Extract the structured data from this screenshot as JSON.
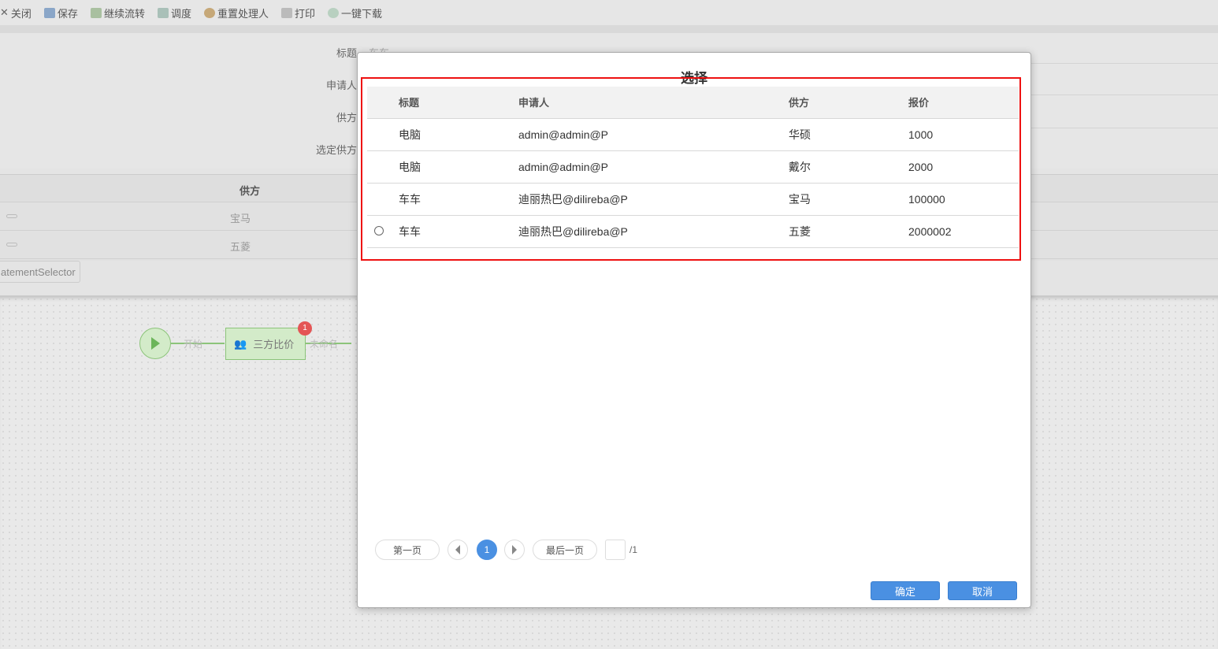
{
  "toolbar": {
    "items": [
      {
        "label": "关闭",
        "icon": "close-icon"
      },
      {
        "label": "保存",
        "icon": "save-icon"
      },
      {
        "label": "继续流转",
        "icon": "forward-icon"
      },
      {
        "label": "调度",
        "icon": "dispatch-icon"
      },
      {
        "label": "重置处理人",
        "icon": "reset-handler-icon"
      },
      {
        "label": "打印",
        "icon": "print-icon"
      },
      {
        "label": "一键下载",
        "icon": "download-icon"
      }
    ]
  },
  "form": {
    "labels": [
      "标题",
      "申请人",
      "供方",
      "选定供方"
    ],
    "title_value": "车车"
  },
  "bg_table": {
    "header": "供方",
    "rows": [
      "宝马",
      "五菱"
    ],
    "selector_label": "atementSelector"
  },
  "flow": {
    "start_label": "开始",
    "node_label": "三方比价",
    "badge": "1",
    "edge_label": "未命名"
  },
  "modal": {
    "title": "选择",
    "columns": [
      "标题",
      "申请人",
      "供方",
      "报价"
    ],
    "rows": [
      {
        "title": "电脑",
        "applicant": "admin@admin@P",
        "supplier": "华硕",
        "price": "1000"
      },
      {
        "title": "电脑",
        "applicant": "admin@admin@P",
        "supplier": "戴尔",
        "price": "2000"
      },
      {
        "title": "车车",
        "applicant": "迪丽热巴@dilireba@P",
        "supplier": "宝马",
        "price": "100000"
      },
      {
        "title": "车车",
        "applicant": "迪丽热巴@dilireba@P",
        "supplier": "五菱",
        "price": "2000002"
      }
    ],
    "pagination": {
      "first": "第一页",
      "current": "1",
      "last": "最后一页",
      "page_input": "",
      "total": "/1"
    },
    "confirm": "确定",
    "cancel": "取消"
  }
}
